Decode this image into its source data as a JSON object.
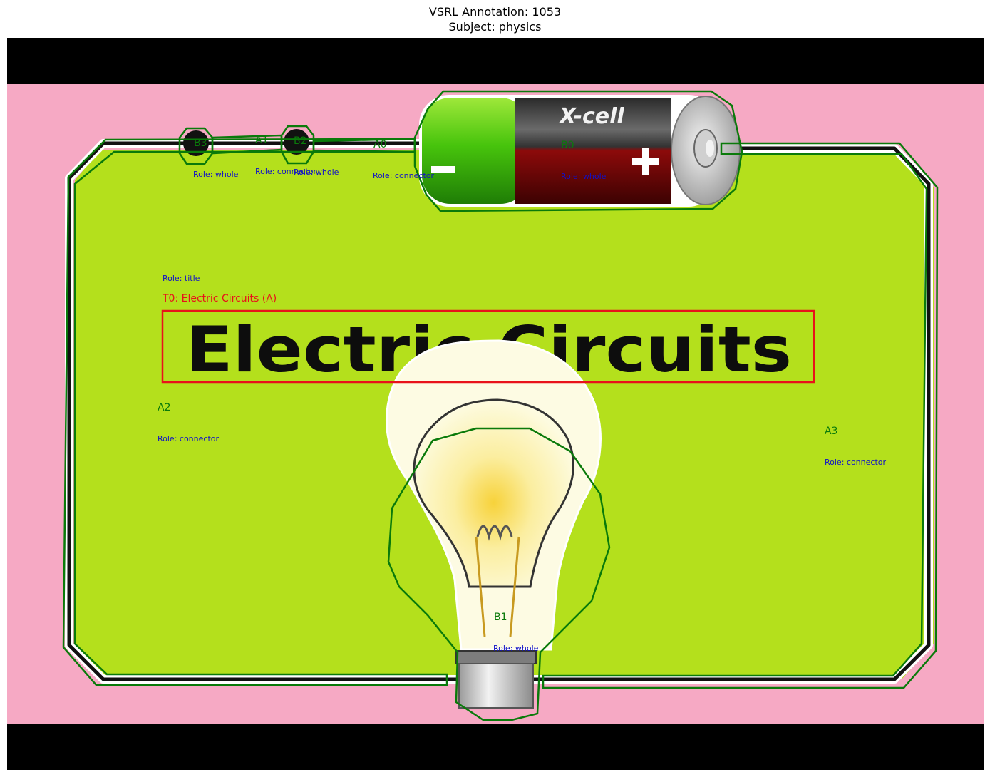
{
  "header": {
    "title": "VSRL Annotation: 1053",
    "subject": "Subject: physics"
  },
  "diagram": {
    "heading": "Electric Circuits",
    "battery_brand": "X-cell",
    "battery_minus": "−",
    "battery_plus": "+"
  },
  "annotations": {
    "title_box": {
      "label": "T0: Electric Circuits (A)",
      "role": "Role: title"
    },
    "B0": {
      "label": "B0",
      "role": "Role: whole"
    },
    "B1": {
      "label": "B1",
      "role": "Role: whole"
    },
    "B2": {
      "label": "B2",
      "role": "Role: whole"
    },
    "B3": {
      "label": "B3",
      "role": "Role: whole"
    },
    "A0": {
      "label": "A0",
      "role": "Role: connector"
    },
    "A1": {
      "label": "A1",
      "role": "Role: connector"
    },
    "A2": {
      "label": "A2",
      "role": "Role: connector"
    },
    "A3": {
      "label": "A3",
      "role": "Role: connector"
    }
  },
  "colors": {
    "background_pink": "#f6a9c4",
    "board_green": "#b4e01c",
    "letterbox": "#000000",
    "outline_green": "#0a7a0a",
    "title_box_red": "#e8121a",
    "role_blue": "#1010c8"
  }
}
